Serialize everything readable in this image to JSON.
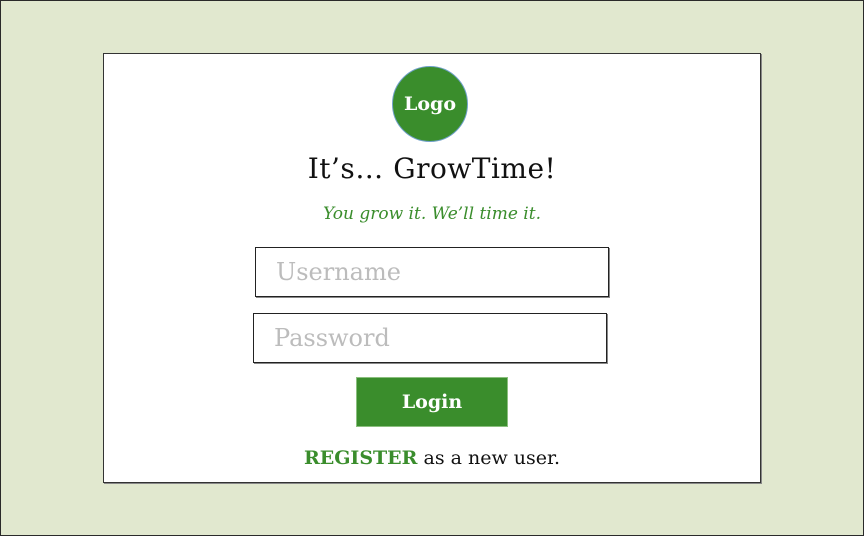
{
  "logo": {
    "label": "Logo"
  },
  "header": {
    "title": "It’s… GrowTime!",
    "tagline": "You grow it. We’ll time it."
  },
  "form": {
    "username_placeholder": "Username",
    "username_value": "",
    "password_placeholder": "Password",
    "password_value": "",
    "login_label": "Login"
  },
  "register": {
    "link_label": "REGISTER",
    "suffix": " as a new user."
  },
  "colors": {
    "background": "#e1e8cf",
    "brand_green": "#3a8d2c",
    "card": "#ffffff"
  }
}
